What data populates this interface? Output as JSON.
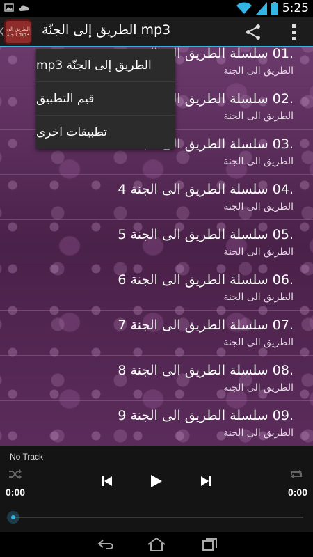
{
  "status_bar": {
    "time": "5:25",
    "icons": [
      "photo-icon",
      "cloud-icon",
      "wifi-icon",
      "signal-icon",
      "battery-icon"
    ]
  },
  "action_bar": {
    "title": "الطريق إلى الجنّة mp3",
    "logo_text": "الطريق الى الجنة mp3",
    "icons": [
      "share-icon",
      "overflow-menu-icon"
    ]
  },
  "tracks": [
    {
      "title": ".01 سلسلة الطريق الى الجنة",
      "subtitle": "الطريق الى الجنة"
    },
    {
      "title": ".02 سلسلة الطريق الى الجنة",
      "subtitle": "الطريق الى الجنة"
    },
    {
      "title": ".03 سلسلة الطريق الى الجنة",
      "subtitle": "الطريق الى الجنة"
    },
    {
      "title": ".04 سلسلة الطريق الى الجنة 4",
      "subtitle": "الطريق الى الجنة"
    },
    {
      "title": ".05 سلسلة الطريق الى الجنة 5",
      "subtitle": "الطريق الى الجنة"
    },
    {
      "title": ".06 سلسلة الطريق الى الجنة 6",
      "subtitle": "الطريق الى الجنة"
    },
    {
      "title": ".07 سلسلة الطريق الى الجنة 7",
      "subtitle": "الطريق الى الجنة"
    },
    {
      "title": ".08 سلسلة الطريق الى الجنة 8",
      "subtitle": "الطريق الى الجنة"
    },
    {
      "title": ".09 سلسلة الطريق الى الجنة 9",
      "subtitle": "الطريق الى الجنة"
    }
  ],
  "menu": {
    "items": [
      "الطريق إلى الجنّة mp3",
      "قيم التطبيق",
      "تطبيقات اخرى"
    ]
  },
  "player": {
    "now_playing": "No Track",
    "elapsed": "0:00",
    "duration": "0:00",
    "progress": 0,
    "icons": [
      "shuffle-icon",
      "previous-icon",
      "play-icon",
      "next-icon",
      "repeat-icon"
    ]
  },
  "nav_bar": {
    "icons": [
      "back-icon",
      "home-icon",
      "recents-icon"
    ]
  },
  "colors": {
    "accent": "#33b5e5",
    "background": "#5f3160",
    "menu": "#2b2b2b"
  }
}
